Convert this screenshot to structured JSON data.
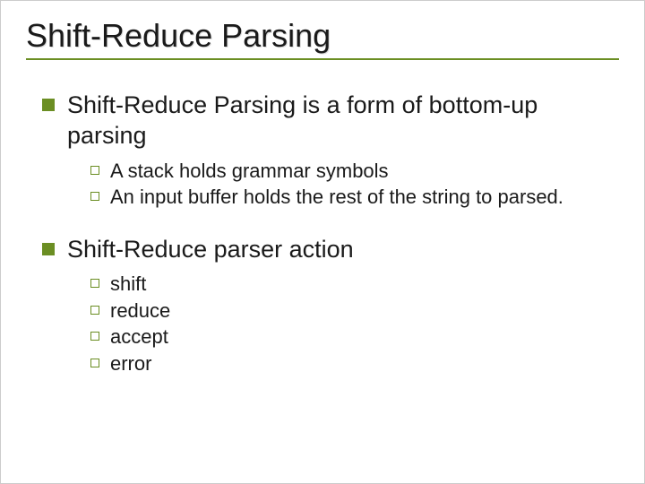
{
  "title": "Shift-Reduce Parsing",
  "points": [
    {
      "text": "Shift-Reduce Parsing is a form of bottom-up parsing",
      "sub": [
        "A stack holds grammar symbols",
        "An input buffer holds the rest of the string to parsed."
      ]
    },
    {
      "text": "Shift-Reduce parser action",
      "sub": [
        "shift",
        "reduce",
        "accept",
        "error"
      ]
    }
  ]
}
